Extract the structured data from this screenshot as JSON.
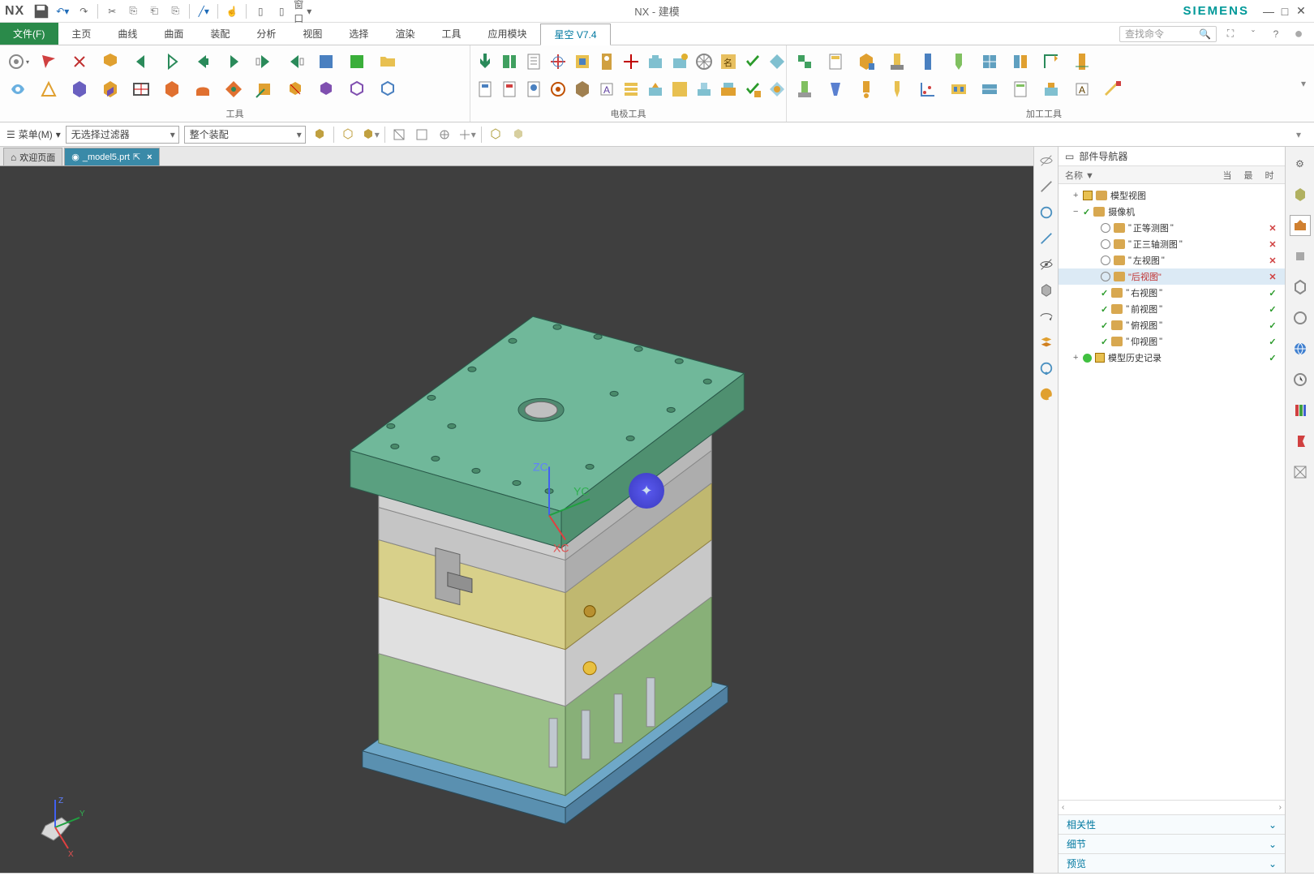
{
  "titlebar": {
    "logo": "NX",
    "center": "NX - 建模",
    "brand": "SIEMENS",
    "window_dropdown": "窗口"
  },
  "menutabs": {
    "file": "文件(F)",
    "items": [
      "主页",
      "曲线",
      "曲面",
      "装配",
      "分析",
      "视图",
      "选择",
      "渲染",
      "工具",
      "应用模块",
      "星空 V7.4"
    ],
    "active_index": 10,
    "search_placeholder": "查找命令"
  },
  "ribbon": {
    "group1_label": "工具",
    "group2_label": "电极工具",
    "group3_label": "加工工具"
  },
  "selbar": {
    "menu_label": "菜单(M)",
    "filter1": "无选择过滤器",
    "filter2": "整个装配"
  },
  "doctabs": {
    "welcome": "欢迎页面",
    "file": "_model5.prt"
  },
  "triad_labels": {
    "x": "XC",
    "y": "YC",
    "z": "ZC",
    "sx": "X",
    "sy": "Y",
    "sz": "Z"
  },
  "panel": {
    "title": "部件导航器",
    "col_name": "名称",
    "col_cur": "当",
    "col_fin": "最",
    "col_time": "时",
    "tree": {
      "model_views": "模型视图",
      "cameras": "摄像机",
      "cam_items": [
        {
          "name": "正等测图",
          "status": "x"
        },
        {
          "name": "正三轴测图",
          "status": "x"
        },
        {
          "name": "左视图",
          "status": "x"
        },
        {
          "name": "后视图",
          "status": "x",
          "selected": true,
          "red": true
        },
        {
          "name": "右视图",
          "status": "chk",
          "tick": true
        },
        {
          "name": "前视图",
          "status": "chk",
          "tick": true
        },
        {
          "name": "俯视图",
          "status": "chk",
          "tick": true
        },
        {
          "name": "仰视图",
          "status": "chk",
          "tick": true
        }
      ],
      "history": "模型历史记录"
    },
    "acc1": "相关性",
    "acc2": "细节",
    "acc3": "预览"
  }
}
